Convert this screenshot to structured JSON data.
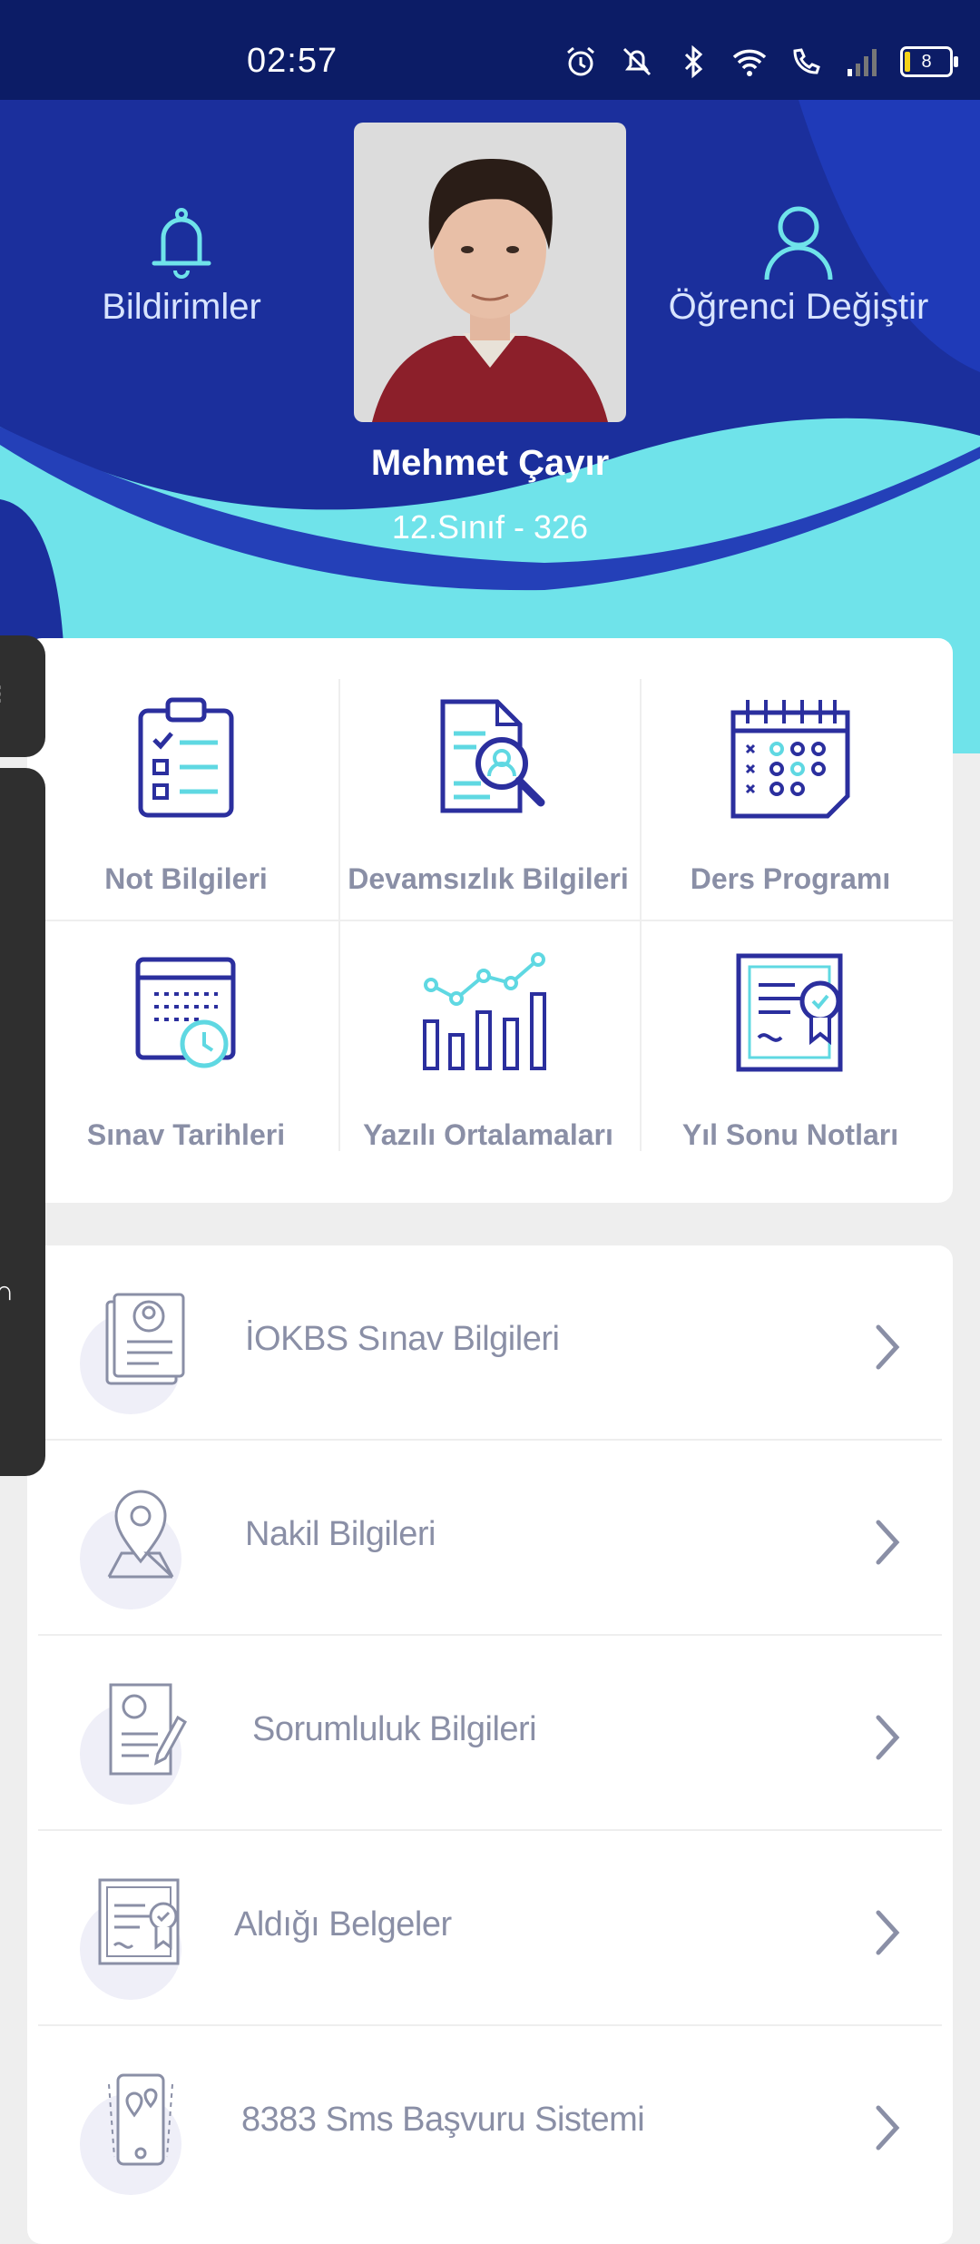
{
  "status_bar": {
    "time": "02:57",
    "battery": "8",
    "icons": [
      "alarm-icon",
      "mute-icon",
      "bluetooth-icon",
      "wifi-icon",
      "wifi-calling-icon",
      "signal-icon",
      "battery-icon"
    ]
  },
  "header": {
    "notifications_label": "Bildirimler",
    "switch_student_label": "Öğrenci Değiştir",
    "student_name": "Mehmet Çayır",
    "student_class": "12.Sınıf - 326",
    "colors": {
      "dark_blue": "#1b2f9c",
      "accent_cyan": "#6fe3ea"
    }
  },
  "grid": {
    "items": [
      {
        "label": "Not Bilgileri",
        "icon": "clipboard-checklist-icon"
      },
      {
        "label": "Devamsızlık Bilgileri",
        "icon": "document-search-icon"
      },
      {
        "label": "Ders Programı",
        "icon": "calendar-schedule-icon"
      },
      {
        "label": "Sınav Tarihleri",
        "icon": "calendar-clock-icon"
      },
      {
        "label": "Yazılı Ortalamaları",
        "icon": "bar-chart-icon"
      },
      {
        "label": "Yıl Sonu Notları",
        "icon": "certificate-icon"
      }
    ]
  },
  "list": {
    "items": [
      {
        "label": "İOKBS Sınav Bilgileri",
        "icon": "id-card-icon"
      },
      {
        "label": "Nakil Bilgileri",
        "icon": "location-pin-icon"
      },
      {
        "label": "Sorumluluk Bilgileri",
        "icon": "profile-document-icon"
      },
      {
        "label": "Aldığı Belgeler",
        "icon": "certificate-document-icon"
      },
      {
        "label": "8383 Sms Başvuru Sistemi",
        "icon": "phone-location-icon"
      }
    ]
  }
}
